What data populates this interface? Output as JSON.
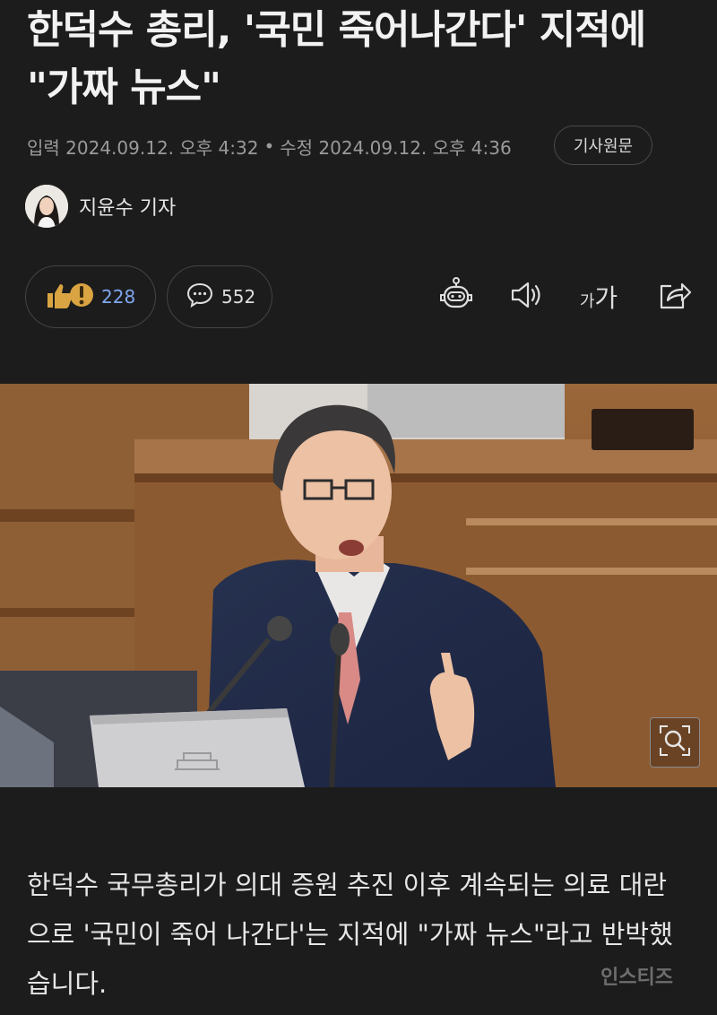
{
  "article": {
    "headline": "한덕수 총리, '국민 죽어나간다' 지적에 \"가짜 뉴스\"",
    "meta_input": "입력 2024.09.12. 오후 4:32",
    "meta_sep": "•",
    "meta_edit": "수정 2024.09.12. 오후 4:36",
    "original_button": "기사원문",
    "author": "지윤수 기자",
    "reactions_count": "228",
    "comments_count": "552",
    "font_size_label_small": "가",
    "font_size_label_large": "가",
    "body": "한덕수 국무총리가 의대 증원 추진 이후 계속되는 의료 대란으로 '국민이 죽어 나간다'는 지적에 \"가짜 뉴스\"라고 반박했습니다."
  },
  "watermark": "인스티즈",
  "icons": {
    "reaction": "thumbs-up-exclaim-icon",
    "comment": "speech-bubble-icon",
    "ai_summary": "robot-icon",
    "listen": "speaker-icon",
    "font_size": "font-size-icon",
    "share": "share-icon",
    "zoom": "zoom-search-icon"
  },
  "colors": {
    "background": "#1c1c1c",
    "reaction_count": "#7fa7f0",
    "reaction_icon": "#d9a441"
  }
}
